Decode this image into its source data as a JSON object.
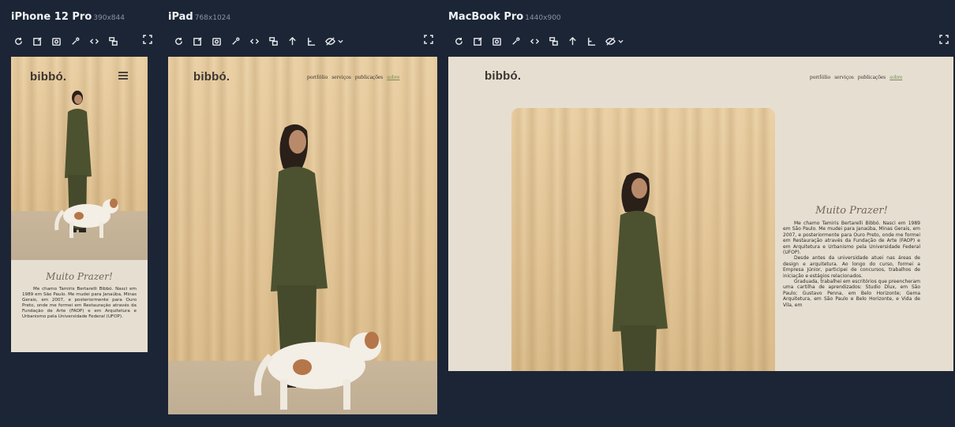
{
  "panels": {
    "iphone": {
      "name": "iPhone 12 Pro",
      "dims": "390x844"
    },
    "ipad": {
      "name": "iPad",
      "dims": "768x1024"
    },
    "macbook": {
      "name": "MacBook Pro",
      "dims": "1440x900"
    }
  },
  "toolbar_icons": [
    "refresh-icon",
    "edit-screenshot-icon",
    "camera-icon",
    "color-picker-icon",
    "code-icon",
    "layout-icon",
    "scroll-up-icon",
    "ruler-icon",
    "eye-off-icon",
    "chevron-down-icon",
    "expand-icon"
  ],
  "site": {
    "logo": "bibbó.",
    "nav": [
      "portfólio",
      "serviços",
      "publicações",
      "sobre"
    ],
    "active_nav": "sobre",
    "heading": "Muito Prazer!",
    "paragraphs": [
      "Me chamo Tamiris Bertarelli Bibbó. Nasci em 1989 em São Paulo. Me mudei para Janaúba, Minas Gerais, em 2007, e posteriormente para Ouro Preto, onde me formei em Restauração através da Fundação de Arte (FAOP) e em Arquitetura e Urbanismo pela Universidade Federal (UFOP).",
      "Desde antes da universidade atuei nas áreas de design e arquitetura. Ao longo do curso, formei a Empresa Júnior, participei de concursos, trabalhos de iniciação e estágios relacionados.",
      "Graduada, trabalhei em escritórios que preencheram uma cartilha de aprendizados: Studio Dlux, em São Paulo; Gustavo Penna, em Belo Horizonte; Gema Arquitetura, em São Paulo e Belo Horizonte, e Vida de Vila, em"
    ]
  },
  "colors": {
    "background": "#1c2535",
    "site_background": "#e6dfd1",
    "nav_active": "#7a8a55",
    "outfit": "#4c5230"
  }
}
